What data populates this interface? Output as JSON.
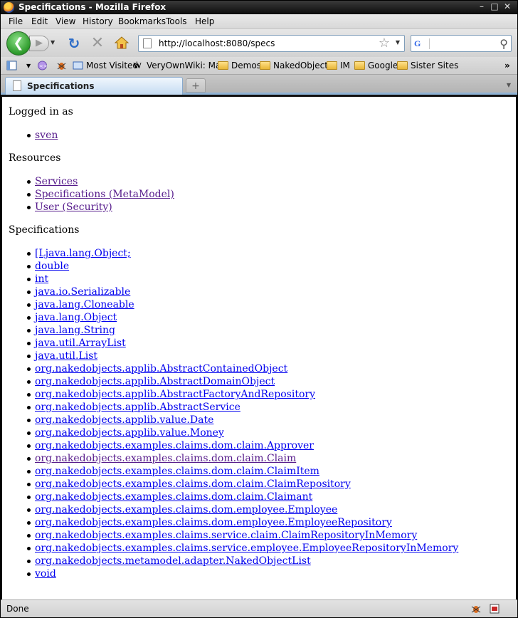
{
  "window": {
    "title": "Specifications - Mozilla Firefox"
  },
  "menubar": {
    "items": [
      "File",
      "Edit",
      "View",
      "History",
      "Bookmarks",
      "Tools",
      "Help"
    ]
  },
  "navbar": {
    "url": "http://localhost:8080/specs",
    "search_engine_letter": "G"
  },
  "bookmarks": [
    "Most Visited",
    "VeryOwnWiki: Main",
    "Demos",
    "NakedObjects",
    "IM",
    "Google",
    "Sister Sites"
  ],
  "tab": {
    "label": "Specifications"
  },
  "page": {
    "logged_in_heading": "Logged in as",
    "user": "sven",
    "resources_heading": "Resources",
    "resources": [
      "Services",
      "Specifications (MetaModel)",
      "User (Security)"
    ],
    "specifications_heading": "Specifications",
    "specifications": [
      "[Ljava.lang.Object;",
      "double",
      "int",
      "java.io.Serializable",
      "java.lang.Cloneable",
      "java.lang.Object",
      "java.lang.String",
      "java.util.ArrayList",
      "java.util.List",
      "org.nakedobjects.applib.AbstractContainedObject",
      "org.nakedobjects.applib.AbstractDomainObject",
      "org.nakedobjects.applib.AbstractFactoryAndRepository",
      "org.nakedobjects.applib.AbstractService",
      "org.nakedobjects.applib.value.Date",
      "org.nakedobjects.applib.value.Money",
      "org.nakedobjects.examples.claims.dom.claim.Approver",
      "org.nakedobjects.examples.claims.dom.claim.Claim",
      "org.nakedobjects.examples.claims.dom.claim.ClaimItem",
      "org.nakedobjects.examples.claims.dom.claim.ClaimRepository",
      "org.nakedobjects.examples.claims.dom.claim.Claimant",
      "org.nakedobjects.examples.claims.dom.employee.Employee",
      "org.nakedobjects.examples.claims.dom.employee.EmployeeRepository",
      "org.nakedobjects.examples.claims.service.claim.ClaimRepositoryInMemory",
      "org.nakedobjects.examples.claims.service.employee.EmployeeRepositoryInMemory",
      "org.nakedobjects.metamodel.adapter.NakedObjectList",
      "void"
    ]
  },
  "statusbar": {
    "text": "Done"
  },
  "colors": {
    "link": "#0000ee",
    "visited_link": "#551a8b",
    "back_button": "#2c9a2a"
  }
}
